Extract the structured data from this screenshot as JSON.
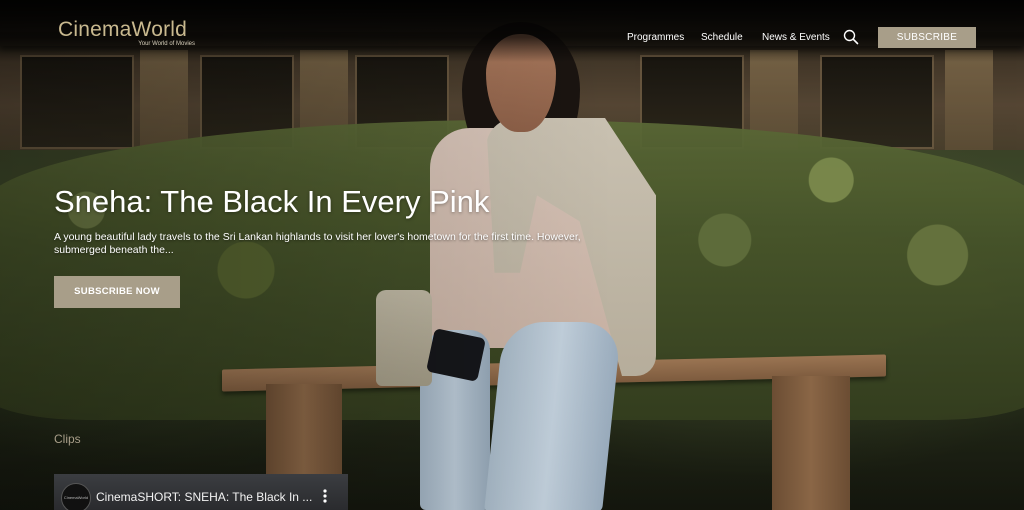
{
  "brand": {
    "name": "CinemaWorld",
    "tagline": "Your World of Movies"
  },
  "nav": {
    "items": [
      {
        "label": "Programmes"
      },
      {
        "label": "Schedule"
      },
      {
        "label": "News & Events"
      }
    ],
    "search_icon": "search-icon",
    "subscribe_label": "SUBSCRIBE"
  },
  "hero": {
    "title": "Sneha: The Black In Every Pink",
    "description": "A young beautiful lady travels to the Sri Lankan highlands to visit her lover's hometown for the first time. However, submerged beneath the...",
    "cta_label": "SUBSCRIBE NOW"
  },
  "clips": {
    "heading": "Clips",
    "items": [
      {
        "channel": "CinemaWorld",
        "title": "CinemaSHORT: SNEHA: The Black In ...",
        "menu_icon": "more-vertical-icon"
      }
    ]
  },
  "colors": {
    "accent": "#a89e89",
    "logo": "#c9b98f",
    "text": "#ffffff"
  }
}
